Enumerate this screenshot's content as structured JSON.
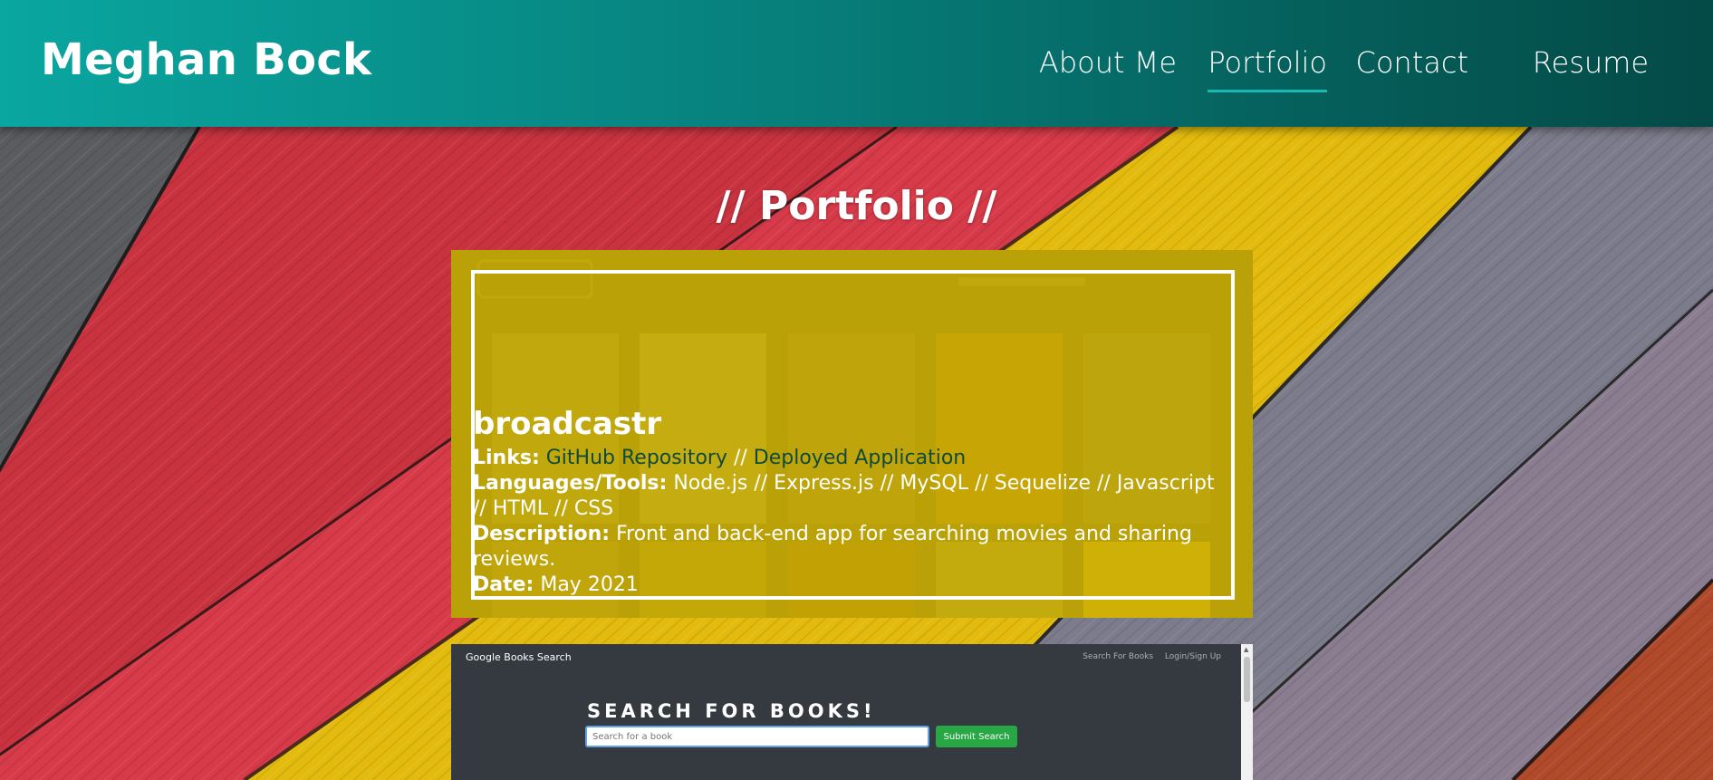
{
  "header": {
    "brand": "Meghan Bock",
    "nav": [
      {
        "label": "About Me",
        "active": false
      },
      {
        "label": "Portfolio",
        "active": true
      },
      {
        "label": "Contact",
        "active": false
      },
      {
        "label": "Resume",
        "active": false
      }
    ]
  },
  "section": {
    "title": "// Portfolio //"
  },
  "projects": [
    {
      "name": "broadcastr",
      "links_label": "Links:",
      "links": [
        "GitHub Repository",
        "Deployed Application"
      ],
      "link_sep": " // ",
      "tools_label": "Languages/Tools:",
      "tools": "Node.js // Express.js // MySQL // Sequelize // Javascript // HTML // CSS",
      "description_label": "Description:",
      "description": "Front and back-end app for searching movies and sharing reviews.",
      "date_label": "Date:",
      "date": "May 2021"
    }
  ],
  "second_project_preview": {
    "app_title": "Google Books Search",
    "nav": [
      "Search For Books",
      "Login/Sign Up"
    ],
    "heading": "SEARCH FOR BOOKS!",
    "search_placeholder": "Search for a book",
    "submit_label": "Submit Search"
  },
  "colors": {
    "header_start": "#0aa6a0",
    "header_end": "#044a47",
    "card_overlay": "#d2b400",
    "link": "#104a3c",
    "submit_button": "#28a745"
  }
}
